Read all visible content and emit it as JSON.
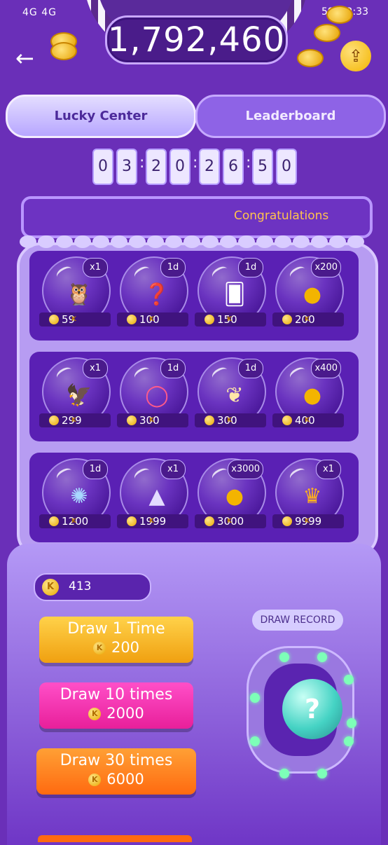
{
  "status_bar": {
    "signal": "4G 4G",
    "battery": "59%",
    "time": "2:33"
  },
  "header": {
    "coins": "1,792,460",
    "back_icon": "arrow-left-icon",
    "share_icon": "share-icon"
  },
  "tabs": [
    {
      "label": "Lucky Center",
      "active": true
    },
    {
      "label": "Leaderboard",
      "active": false
    }
  ],
  "countdown": [
    "0",
    "3",
    "2",
    "0",
    "2",
    "6",
    "5",
    "0"
  ],
  "marquee": {
    "text": "Congratulations"
  },
  "prizes": [
    [
      {
        "tag": "x1",
        "price": "59",
        "icon": "owl-icon"
      },
      {
        "tag": "1d",
        "price": "100",
        "icon": "mystery-box-icon"
      },
      {
        "tag": "1d",
        "price": "150",
        "icon": "card-icon"
      },
      {
        "tag": "x200",
        "price": "200",
        "icon": "gold-coins-icon"
      }
    ],
    [
      {
        "tag": "x1",
        "price": "299",
        "icon": "eagle-icon"
      },
      {
        "tag": "1d",
        "price": "300",
        "icon": "frame-icon"
      },
      {
        "tag": "1d",
        "price": "300",
        "icon": "wings-icon"
      },
      {
        "tag": "x400",
        "price": "400",
        "icon": "gold-coins-icon"
      }
    ],
    [
      {
        "tag": "1d",
        "price": "1200",
        "icon": "galaxy-icon"
      },
      {
        "tag": "x1",
        "price": "1999",
        "icon": "rocket-icon"
      },
      {
        "tag": "x3000",
        "price": "3000",
        "icon": "gold-coins-icon"
      },
      {
        "tag": "x1",
        "price": "9999",
        "icon": "crown-icon"
      }
    ]
  ],
  "balance": "413",
  "draws": [
    {
      "label": "Draw 1 Time",
      "cost": "200"
    },
    {
      "label": "Draw 10 times",
      "cost": "2000"
    },
    {
      "label": "Draw 30 times",
      "cost": "6000"
    }
  ],
  "draw_record_label": "DRAW RECORD",
  "colors": {
    "background": "#6a2fb8",
    "accent_gold": "#ffc34d",
    "draw1": "#f0a010",
    "draw10": "#e81f9a",
    "draw30": "#ff6a10"
  }
}
